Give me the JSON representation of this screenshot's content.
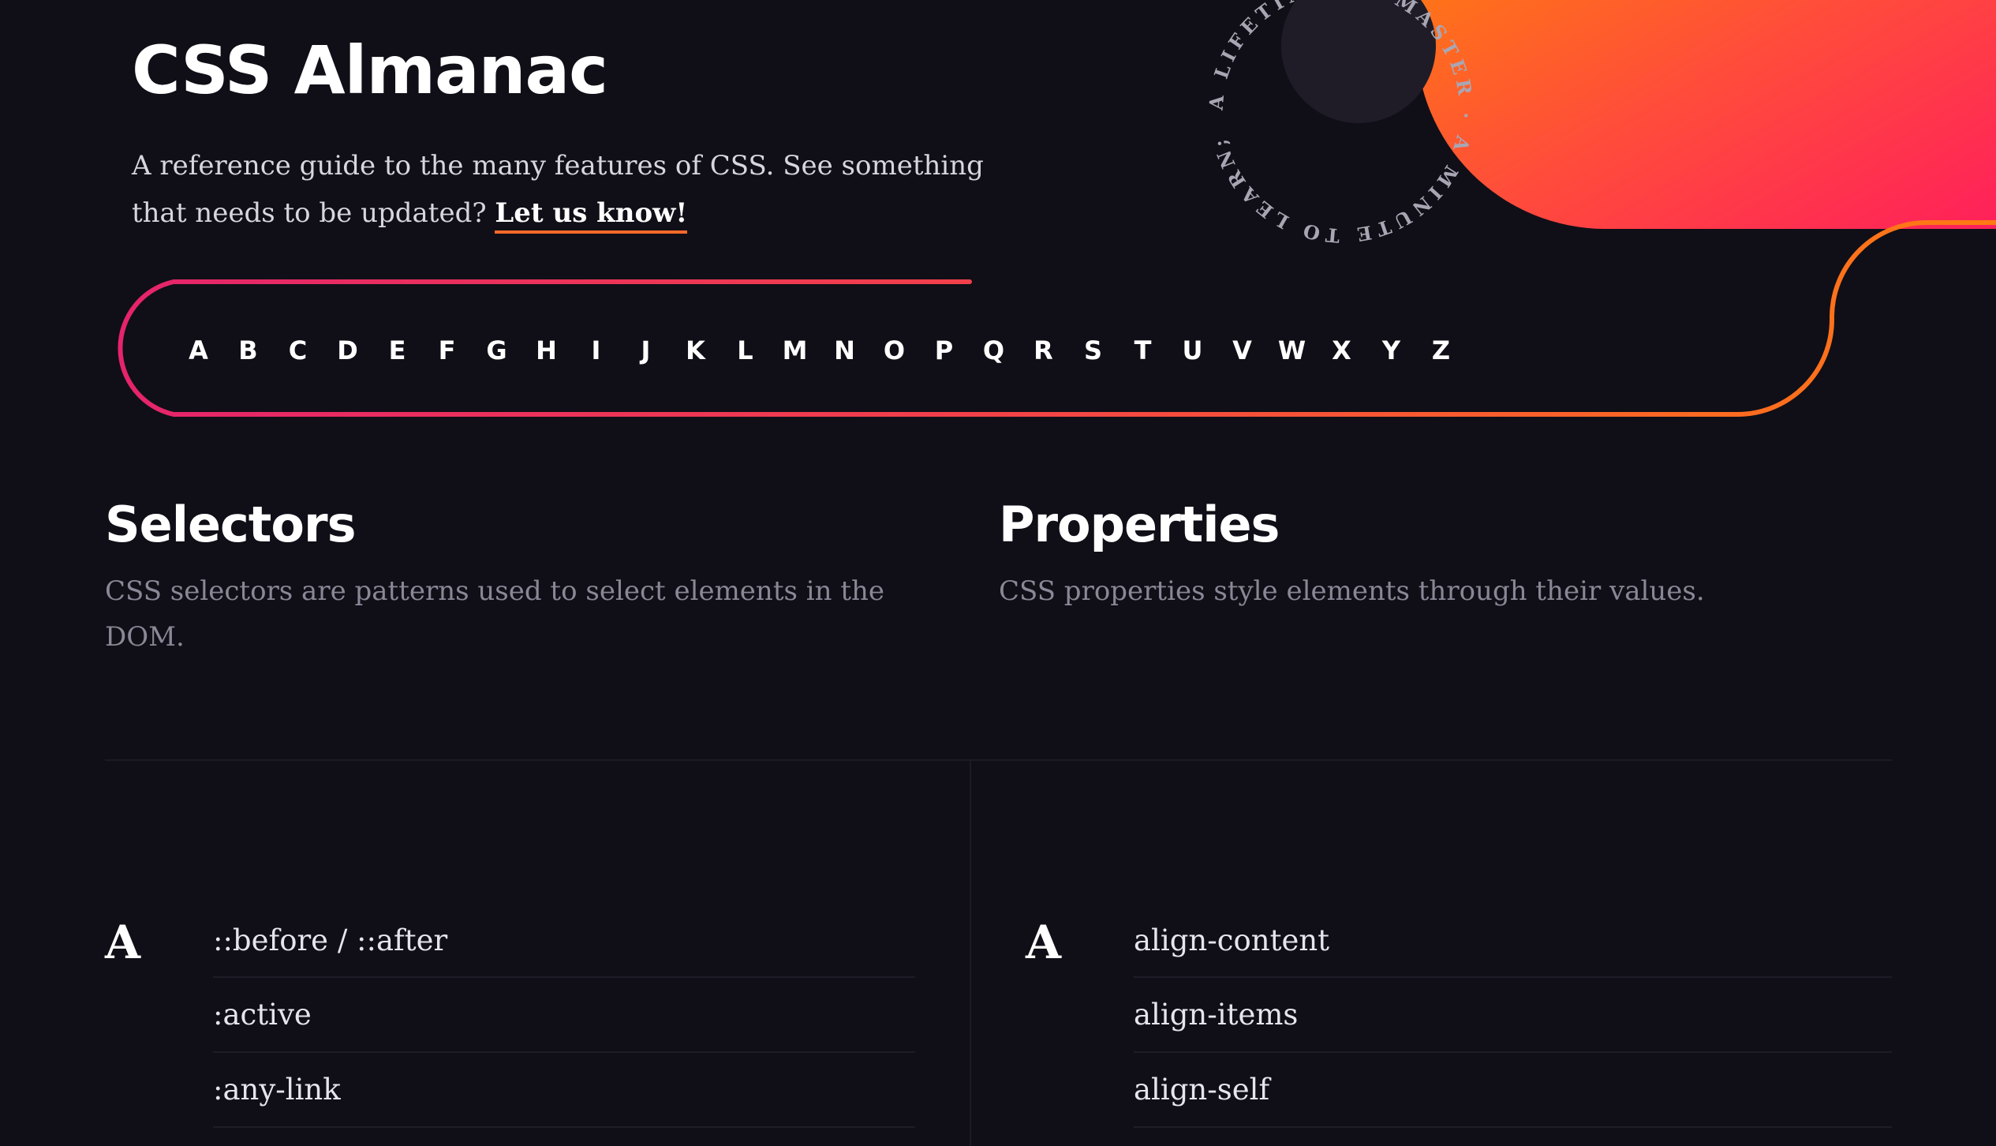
{
  "header": {
    "title": "CSS Almanac",
    "intro_text": "A reference guide to the many features of CSS. See something that needs to be updated? ",
    "intro_link": "Let us know!"
  },
  "badge": {
    "circular_text": "A LIFETIME TO MASTER · A MINUTE TO LEARN; "
  },
  "alphabet_nav": [
    "A",
    "B",
    "C",
    "D",
    "E",
    "F",
    "G",
    "H",
    "I",
    "J",
    "K",
    "L",
    "M",
    "N",
    "O",
    "P",
    "Q",
    "R",
    "S",
    "T",
    "U",
    "V",
    "W",
    "X",
    "Y",
    "Z"
  ],
  "colors": {
    "background": "#100f17",
    "accent_pink": "#e5246b",
    "accent_orange": "#ff7a12"
  },
  "selectors": {
    "heading": "Selectors",
    "description": "CSS selectors are patterns used to select elements in the DOM.",
    "group_letter": "A",
    "items": [
      "::before / ::after",
      ":active",
      ":any-link"
    ]
  },
  "properties": {
    "heading": "Properties",
    "description": "CSS properties style elements through their values.",
    "group_letter": "A",
    "items": [
      "align-content",
      "align-items",
      "align-self"
    ]
  }
}
